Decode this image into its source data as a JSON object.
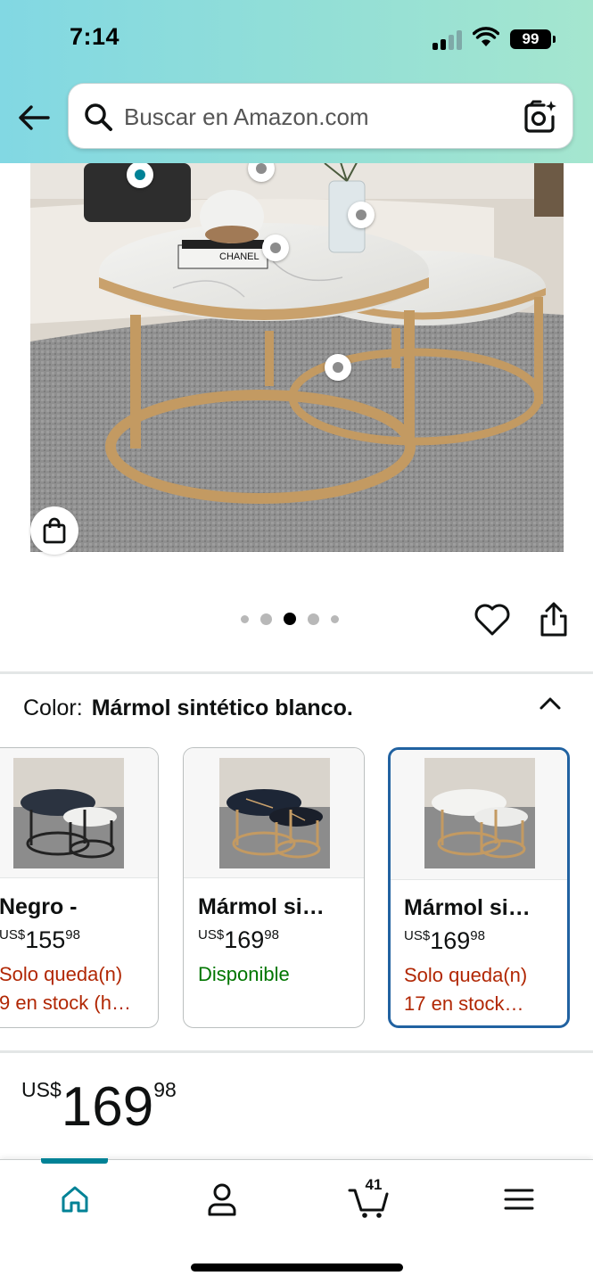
{
  "status_bar": {
    "time": "7:14",
    "battery": "99"
  },
  "search": {
    "placeholder": "Buscar en Amazon.com"
  },
  "product_image": {
    "carousel": {
      "count": 5,
      "active_index": 2
    },
    "box_text": "CHANEL"
  },
  "color": {
    "label": "Color:",
    "value": "Mármol sintético blanco."
  },
  "variants": [
    {
      "name": "Negro -",
      "currency": "US$",
      "price_whole": "155",
      "price_cents": "98",
      "stock_line1": "Solo queda(n)",
      "stock_line2": "9 en stock (h…",
      "stock_status": "low",
      "selected": false
    },
    {
      "name": "Mármol si…",
      "currency": "US$",
      "price_whole": "169",
      "price_cents": "98",
      "stock_line1": "Disponible",
      "stock_line2": "",
      "stock_status": "available",
      "selected": false
    },
    {
      "name": "Mármol si…",
      "currency": "US$",
      "price_whole": "169",
      "price_cents": "98",
      "stock_line1": "Solo queda(n)",
      "stock_line2": "17 en stock…",
      "stock_status": "low",
      "selected": true
    }
  ],
  "price": {
    "currency": "US$",
    "whole": "169",
    "cents": "98"
  },
  "nav": {
    "items": [
      {
        "icon": "home-icon",
        "active": true
      },
      {
        "icon": "account-icon",
        "active": false
      },
      {
        "icon": "cart-icon",
        "active": false
      },
      {
        "icon": "menu-icon",
        "active": false
      }
    ],
    "cart_count": "41"
  },
  "colors": {
    "accent_teal": "#008296",
    "selected_border": "#2162a1",
    "stock_red": "#b12704",
    "stock_green": "#007600"
  }
}
